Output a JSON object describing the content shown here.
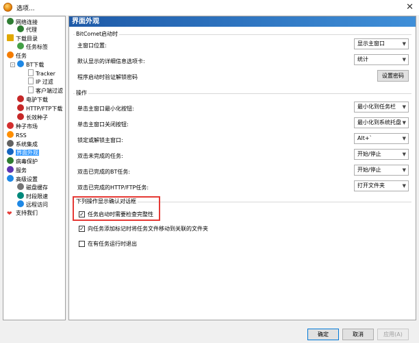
{
  "window": {
    "title": "选项...",
    "close_glyph": "✕"
  },
  "tree": [
    {
      "label": "网络连接",
      "icon": "network-icon",
      "color": "#2e7d32"
    },
    {
      "label": "代理",
      "icon": "proxy-icon",
      "color": "#2e7d32"
    },
    {
      "label": "下载目录",
      "icon": "folder-icon",
      "color": "#e0a800"
    },
    {
      "label": "任务标签",
      "icon": "tag-icon",
      "color": "#43a047"
    },
    {
      "label": "任务",
      "icon": "task-icon",
      "color": "#f57c00"
    },
    {
      "label": "BT下载",
      "icon": "bt-icon",
      "color": "#1e88e5"
    },
    {
      "label": "Tracker",
      "icon": "page-icon",
      "color": "#9e9e9e"
    },
    {
      "label": "IP 过滤",
      "icon": "page-icon",
      "color": "#9e9e9e"
    },
    {
      "label": "客户端过滤",
      "icon": "page-icon",
      "color": "#9e9e9e"
    },
    {
      "label": "电驴下载",
      "icon": "emule-icon",
      "color": "#c62828"
    },
    {
      "label": "HTTP/FTP下载",
      "icon": "http-icon",
      "color": "#c62828"
    },
    {
      "label": "长效种子",
      "icon": "seed-icon",
      "color": "#c62828"
    },
    {
      "label": "种子市场",
      "icon": "magnet-icon",
      "color": "#d32f2f"
    },
    {
      "label": "RSS",
      "icon": "rss-icon",
      "color": "#ff8f00"
    },
    {
      "label": "系统集成",
      "icon": "system-icon",
      "color": "#616161"
    },
    {
      "label": "界面外观",
      "icon": "appearance-icon",
      "color": "#1565c0"
    },
    {
      "label": "病毒保护",
      "icon": "shield-icon",
      "color": "#2e7d32"
    },
    {
      "label": "服务",
      "icon": "service-icon",
      "color": "#5e35b1"
    },
    {
      "label": "高级设置",
      "icon": "advanced-icon",
      "color": "#1e88e5"
    },
    {
      "label": "磁盘缓存",
      "icon": "disk-icon",
      "color": "#757575"
    },
    {
      "label": "时段限速",
      "icon": "clock-icon",
      "color": "#00897b"
    },
    {
      "label": "远程访问",
      "icon": "remote-icon",
      "color": "#1e88e5"
    },
    {
      "label": "支持我们",
      "icon": "heart-icon",
      "color": "#e53935"
    }
  ],
  "panel": {
    "title": "界面外观",
    "groups": {
      "startup": "BitComet启动时",
      "actions": "操作",
      "confirm": "下列操作显示确认对话框"
    },
    "startup": {
      "main_window_label": "主窗口位置:",
      "main_window_value": "显示主窗口",
      "detail_tab_label": "默认显示的详细信息选项卡:",
      "detail_tab_value": "统计",
      "password_label": "程序启动时验证解锁密码",
      "password_button": "设置密码"
    },
    "actions": [
      {
        "label": "单击主窗口最小化按钮:",
        "value": "最小化到任务栏"
      },
      {
        "label": "单击主窗口关闭按钮:",
        "value": "最小化到系统托盘"
      },
      {
        "label": "锁定或解锁主窗口:",
        "value": "Alt+`"
      },
      {
        "label": "双击未完成的任务:",
        "value": "开始/停止"
      },
      {
        "label": "双击已完成的BT任务:",
        "value": "开始/停止"
      },
      {
        "label": "双击已完成的HTTP/FTP任务:",
        "value": "打开文件夹"
      }
    ],
    "confirm": [
      {
        "label": "任务启动时需要检查完整性",
        "checked": true
      },
      {
        "label": "向任务添加标记时将任务文件移动到关联的文件夹",
        "checked": true
      },
      {
        "label": "在有任务运行时退出",
        "checked": false
      }
    ],
    "dropdown_glyph": "▼",
    "check_glyph": "✓"
  },
  "footer": {
    "ok": "确定",
    "cancel": "取消",
    "apply": "应用(A)"
  },
  "colors": {
    "header_start": "#1e5aa8",
    "header_end": "#3f8fd8",
    "selection": "#3399ff",
    "highlight_box": "#e53935"
  }
}
